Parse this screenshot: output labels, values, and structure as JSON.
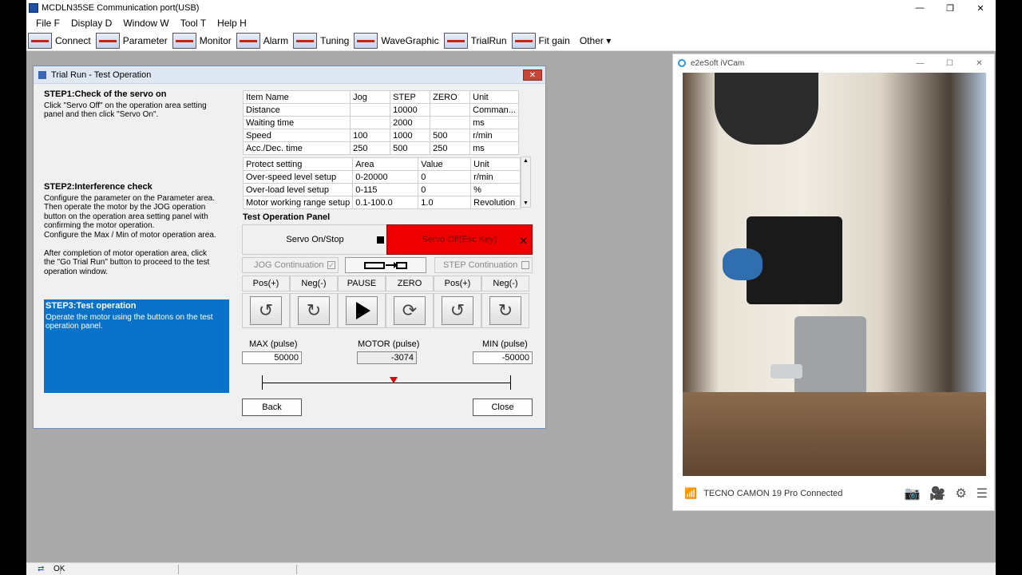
{
  "window": {
    "title": "MCDLN35SE  Communication port(USB)",
    "min": "—",
    "max": "❐",
    "close": "✕"
  },
  "menu": [
    "File F",
    "Display D",
    "Window W",
    "Tool T",
    "Help H"
  ],
  "toolbar": [
    "Connect",
    "Parameter",
    "Monitor",
    "Alarm",
    "Tuning",
    "WaveGraphic",
    "TrialRun",
    "Fit gain"
  ],
  "toolbar_other": "Other ▾",
  "dialog": {
    "title": "Trial Run - Test Operation",
    "close": "✕",
    "step1": {
      "title": "STEP1:Check of the servo on",
      "text": "Click \"Servo Off\" on the operation area setting\npanel and then click \"Servo On\"."
    },
    "step2": {
      "title": "STEP2:Interference check",
      "text": "Configure the parameter on the Parameter area.\nThen operate the motor by the JOG operation\nbutton on the operation area setting panel with\nconfirming the motor operation.\nConfigure the Max / Min of motor operation area.\n\nAfter completion of motor operation area, click\nthe \"Go Trial Run\" button to proceed to the test\noperation window."
    },
    "step3": {
      "title": "STEP3:Test operation",
      "text": "Operate the motor using the buttons on the test\noperation panel."
    },
    "param_table": {
      "headers": [
        "Item Name",
        "Jog",
        "STEP",
        "ZERO",
        "Unit"
      ],
      "rows": [
        [
          "Distance",
          "",
          "10000",
          "",
          "Comman..."
        ],
        [
          "Waiting time",
          "",
          "2000",
          "",
          "ms"
        ],
        [
          "Speed",
          "100",
          "1000",
          "500",
          "r/min"
        ],
        [
          "Acc./Dec. time",
          "250",
          "500",
          "250",
          "ms"
        ]
      ]
    },
    "protect_table": {
      "headers": [
        "Protect setting",
        "Area",
        "Value",
        "Unit"
      ],
      "rows": [
        [
          "Over-speed level setup",
          "0-20000",
          "0",
          "r/min"
        ],
        [
          "Over-load level setup",
          "0-115",
          "0",
          "%"
        ],
        [
          "Motor working range setup",
          "0.1-100.0",
          "1.0",
          "Revolution"
        ]
      ]
    },
    "panel_label": "Test Operation Panel",
    "servo_on_stop": "Servo On/Stop",
    "servo_off": "Servo Off(Esc Key)",
    "servo_off_x": "✕",
    "jog_continuation": "JOG Continuation",
    "step_continuation": "STEP Continuation",
    "jog_check": "✓",
    "op_labels": [
      "Pos(+)",
      "Neg(-)",
      "PAUSE",
      "ZERO",
      "Pos(+)",
      "Neg(-)"
    ],
    "op_icons": [
      "↺",
      "↻",
      "",
      "⟳",
      "↺",
      "↻"
    ],
    "max_label": "MAX (pulse)",
    "motor_label": "MOTOR (pulse)",
    "min_label": "MIN (pulse)",
    "max_value": "50000",
    "motor_value": "-3074",
    "min_value": "-50000",
    "back": "Back",
    "close_btn": "Close"
  },
  "camera": {
    "title": "e2eSoft iVCam",
    "min": "—",
    "max": "☐",
    "close": "✕",
    "status": "TECNO CAMON 19 Pro Connected",
    "icons": [
      "camera-icon",
      "video-icon",
      "gear-icon",
      "menu-icon"
    ]
  },
  "statusbar": {
    "text": "OK"
  }
}
